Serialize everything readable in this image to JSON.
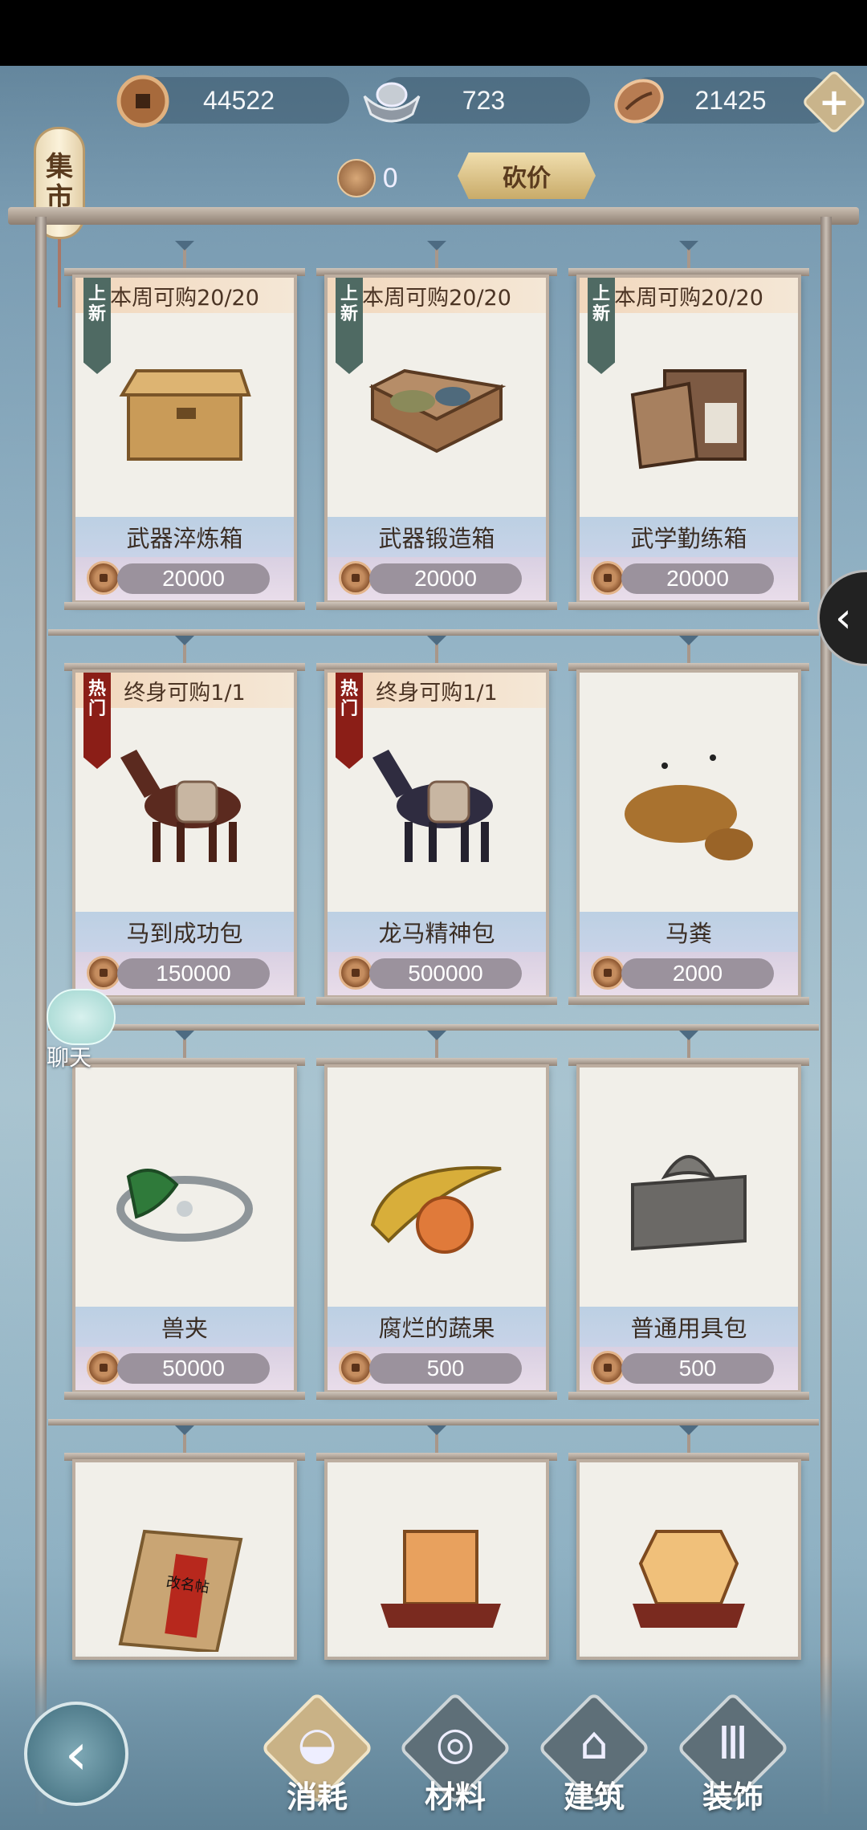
{
  "topbar": {
    "copper_coins": "44522",
    "silver": "723",
    "shells": "21425",
    "add_label": "+"
  },
  "market": {
    "title_char_1": "集",
    "title_char_2": "市",
    "bamboo_count": "0",
    "bargain_label": "砍价"
  },
  "items": [
    {
      "name": "武器淬炼箱",
      "price": "20000",
      "limit": "本周可购20/20",
      "tag_1": "上",
      "tag_2": "新",
      "tag_type": "new"
    },
    {
      "name": "武器锻造箱",
      "price": "20000",
      "limit": "本周可购20/20",
      "tag_1": "上",
      "tag_2": "新",
      "tag_type": "new"
    },
    {
      "name": "武学勤练箱",
      "price": "20000",
      "limit": "本周可购20/20",
      "tag_1": "上",
      "tag_2": "新",
      "tag_type": "new"
    },
    {
      "name": "马到成功包",
      "price": "150000",
      "limit": "终身可购1/1",
      "tag_1": "热",
      "tag_2": "门",
      "tag_type": "hot"
    },
    {
      "name": "龙马精神包",
      "price": "500000",
      "limit": "终身可购1/1",
      "tag_1": "热",
      "tag_2": "门",
      "tag_type": "hot"
    },
    {
      "name": "马粪",
      "price": "2000"
    },
    {
      "name": "兽夹",
      "price": "50000"
    },
    {
      "name": "腐烂的蔬果",
      "price": "500"
    },
    {
      "name": "普通用具包",
      "price": "500"
    },
    {
      "name": "改名帖"
    },
    {
      "name": ""
    },
    {
      "name": ""
    }
  ],
  "chat": {
    "label": "聊天"
  },
  "side_toggle": {
    "label": "‹"
  },
  "nav": {
    "back_label": "‹",
    "tabs": [
      {
        "label": "消耗"
      },
      {
        "label": "材料"
      },
      {
        "label": "建筑"
      },
      {
        "label": "装饰"
      }
    ]
  },
  "colors": {
    "accent_gold": "#c9b286",
    "hot_tag": "#8b1e17",
    "new_tag": "#4f6a63",
    "price_pill": "#9b929d"
  }
}
